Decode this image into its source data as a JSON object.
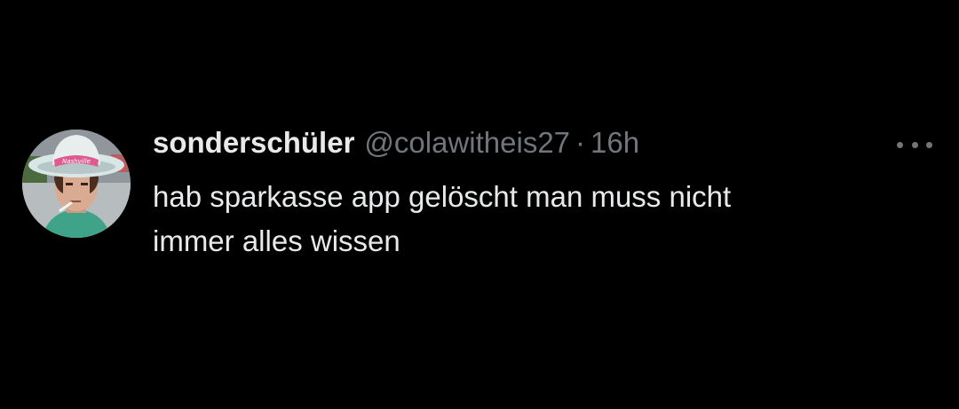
{
  "tweet": {
    "display_name": "sonderschüler",
    "handle": "@colawitheis27",
    "separator": "·",
    "time": "16h",
    "text": "hab sparkasse app gelöscht man muss nicht\nimmer alles wissen",
    "avatar_icon": "profile-photo-cowboy-hat",
    "more_icon": "more-horizontal-icon",
    "hat_text": "Nashville"
  },
  "colors": {
    "background": "#000000",
    "primary_text": "#e7e9ea",
    "secondary_text": "#71767b"
  }
}
